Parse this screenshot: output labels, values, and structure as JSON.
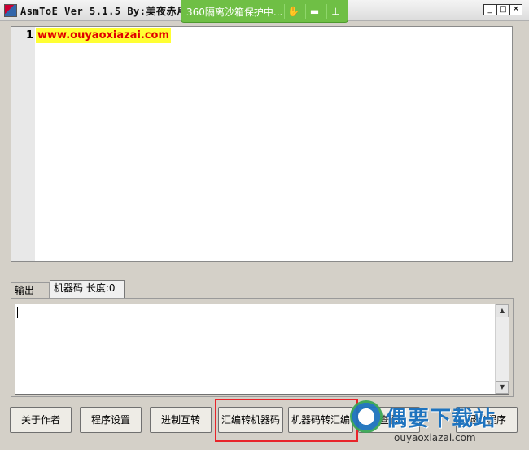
{
  "titlebar": {
    "title": "AsmToE Ver 5.1.5  By:美夜赤月",
    "sandbox_text": "360隔离沙箱保护中...",
    "icons": [
      "hand-icon",
      "folder-icon",
      "pin-icon"
    ],
    "minimize": "_",
    "maximize": "□",
    "close": "✕"
  },
  "editor": {
    "line_number": "1",
    "code_line": "www.ouyaoxiazai.com",
    "highlight_color": "#ffff33",
    "text_color": "#e00000"
  },
  "tabs": [
    {
      "label": "输出"
    },
    {
      "label": "机器码 长度:0"
    }
  ],
  "output": {
    "value": ""
  },
  "buttons": {
    "about": "关于作者",
    "settings": "程序设置",
    "radix": "进制互转",
    "asm_to_machine": "汇编转机器码",
    "machine_to_asm": "机器码转汇编",
    "view": "查看",
    "exit": "退出程序"
  },
  "watermark": {
    "big": "偶要下载站",
    "small": "ouyaoxiazai.com"
  },
  "colors": {
    "sandbox_green": "#6fbf45",
    "highlight_red": "#e8242a",
    "watermark_blue": "#1e73be"
  }
}
